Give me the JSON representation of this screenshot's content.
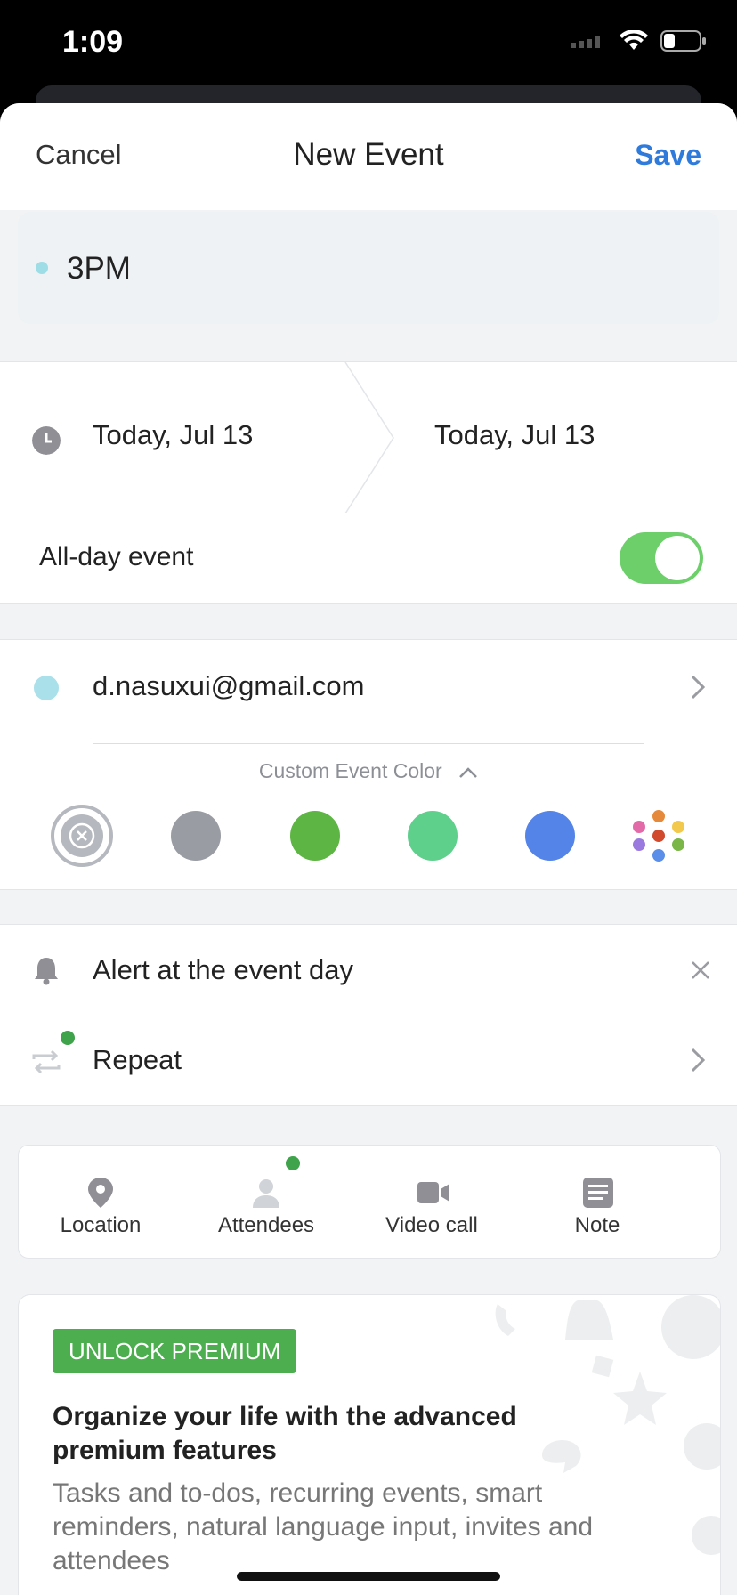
{
  "status": {
    "time": "1:09"
  },
  "nav": {
    "cancel": "Cancel",
    "title": "New Event",
    "save": "Save"
  },
  "event": {
    "title": "3PM",
    "start_date": "Today, Jul 13",
    "end_date": "Today, Jul 13"
  },
  "allday": {
    "label": "All-day event",
    "enabled": true
  },
  "calendar": {
    "account": "d.nasuxui@gmail.com",
    "custom_color_label": "Custom Event Color"
  },
  "colors": {
    "gray": "#9a9ca4",
    "green": "#5db543",
    "mint": "#5fcf8c",
    "blue": "#5584e8",
    "accent": "#2f7bdc",
    "badge": "#4cae4f"
  },
  "alert": {
    "label": "Alert at the event day"
  },
  "repeat": {
    "label": "Repeat"
  },
  "actions": {
    "location": "Location",
    "attendees": "Attendees",
    "video": "Video call",
    "note": "Note"
  },
  "premium": {
    "badge": "UNLOCK PREMIUM",
    "title": "Organize your life with the advanced premium features",
    "desc": "Tasks and to-dos, recurring events, smart reminders, natural language input, invites and attendees"
  }
}
